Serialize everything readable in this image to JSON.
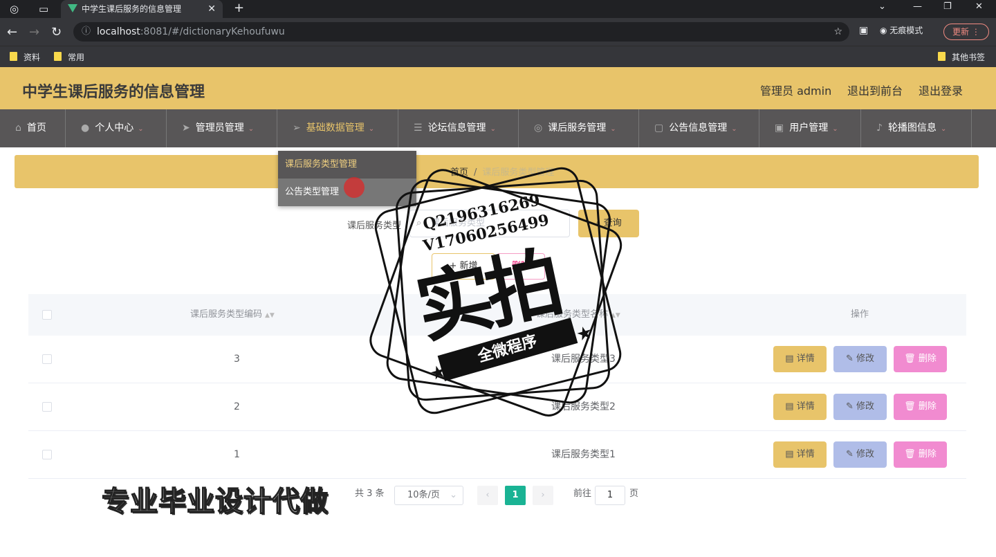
{
  "browser": {
    "tab_title": "中学生课后服务的信息管理",
    "url_host": "localhost",
    "url_rest": ":8081/#/dictionaryKehoufuwu",
    "incognito_label": "无痕模式",
    "update_label": "更新",
    "bookmarks": [
      "资料",
      "常用"
    ],
    "other_bookmarks": "其他书签"
  },
  "header": {
    "title": "中学生课后服务的信息管理",
    "admin": "管理员 admin",
    "front": "退出到前台",
    "logout": "退出登录"
  },
  "nav": {
    "items": [
      {
        "label": "首页",
        "icon": "home-icon"
      },
      {
        "label": "个人中心",
        "icon": "user-icon"
      },
      {
        "label": "管理员管理",
        "icon": "send-icon"
      },
      {
        "label": "基础数据管理",
        "icon": "navigation-icon"
      },
      {
        "label": "论坛信息管理",
        "icon": "menu-icon"
      },
      {
        "label": "课后服务管理",
        "icon": "compass-icon"
      },
      {
        "label": "公告信息管理",
        "icon": "message-icon"
      },
      {
        "label": "用户管理",
        "icon": "document-icon"
      },
      {
        "label": "轮播图信息",
        "icon": "microphone-icon"
      }
    ],
    "dropdown": [
      "课后服务类型管理",
      "公告类型管理"
    ]
  },
  "breadcrumb": {
    "home": "首页",
    "sep": "/",
    "current": "课后服务类型管理"
  },
  "search": {
    "label": "课后服务类型",
    "placeholder": "课后服务类型",
    "query_label": "查询"
  },
  "actions": {
    "add_label": "新增",
    "batch_delete_label": "删除"
  },
  "table": {
    "columns": [
      "课后服务类型编码",
      "课后服务类型名称",
      "操作"
    ],
    "rows": [
      {
        "code": "3",
        "name": "课后服务类型3"
      },
      {
        "code": "2",
        "name": "课后服务类型2"
      },
      {
        "code": "1",
        "name": "课后服务类型1"
      }
    ],
    "row_actions": {
      "detail": "详情",
      "edit": "修改",
      "delete": "删除"
    }
  },
  "pagination": {
    "total": "共 3 条",
    "page_size": "10条/页",
    "current_page": "1",
    "goto_label": "前往",
    "goto_value": "1",
    "page_suffix": "页"
  },
  "watermark": {
    "stamp_main": "实拍",
    "stamp_band": "全微程序",
    "qq": "Q2196316269",
    "wx": "V17060256499",
    "bottom_text": "专业毕业设计代做"
  },
  "colors": {
    "header_bg": "#e8c46a",
    "nav_bg": "#585657",
    "page_active": "#1ab394"
  }
}
